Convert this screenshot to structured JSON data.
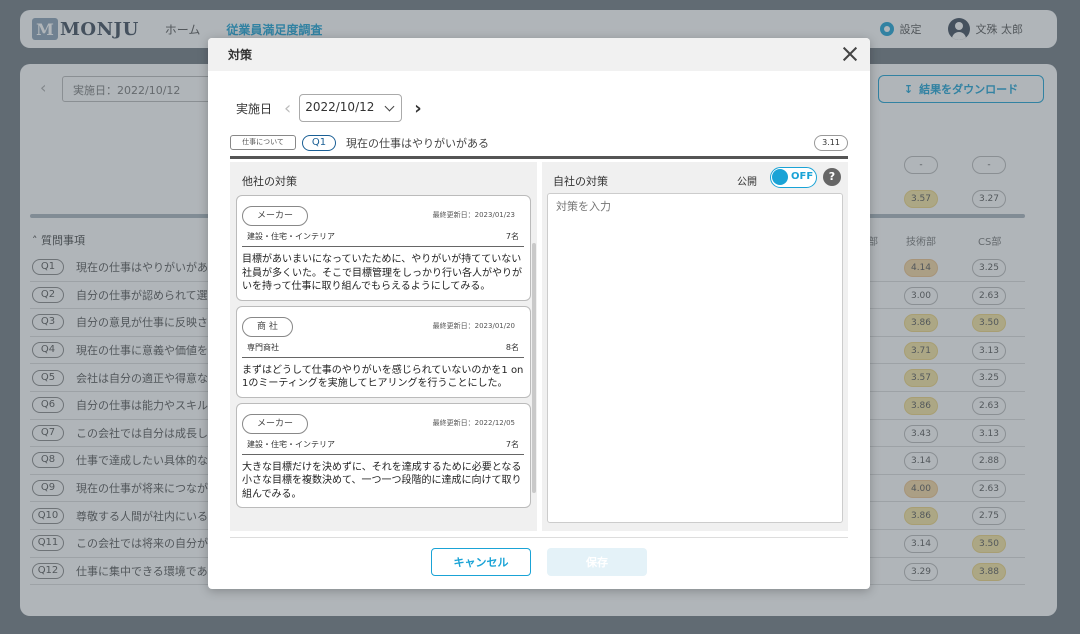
{
  "app": {
    "logo": "MONJU",
    "nav": [
      "ホーム",
      "従業員満足度調査"
    ],
    "settings_label": "設定",
    "user_name": "文殊 太郎"
  },
  "background": {
    "date_field": "実施日：2022/10/12",
    "download_label": "結果をダウンロード",
    "section_title": "質問事項",
    "columns": [
      "部",
      "技術部",
      "CS部"
    ],
    "summary_scores": [
      "-",
      "-",
      "3.57",
      "3.27"
    ],
    "rows": [
      {
        "q": "Q1",
        "text": "現在の仕事はやりがいがあ",
        "s1": "4.14",
        "s2": "3.25"
      },
      {
        "q": "Q2",
        "text": "自分の仕事が認められて選",
        "s1": "3.00",
        "s2": "2.63"
      },
      {
        "q": "Q3",
        "text": "自分の意見が仕事に反映さ",
        "s1": "3.86",
        "s2": "3.50"
      },
      {
        "q": "Q4",
        "text": "現在の仕事に意義や価値を",
        "s1": "3.71",
        "s2": "3.13"
      },
      {
        "q": "Q5",
        "text": "会社は自分の適正や得意な",
        "s1": "3.57",
        "s2": "3.25"
      },
      {
        "q": "Q6",
        "text": "自分の仕事は能力やスキル",
        "s1": "3.86",
        "s2": "2.63"
      },
      {
        "q": "Q7",
        "text": "この会社では自分は成長し",
        "s1": "3.43",
        "s2": "3.13"
      },
      {
        "q": "Q8",
        "text": "仕事で達成したい具体的な",
        "s1": "3.14",
        "s2": "2.88"
      },
      {
        "q": "Q9",
        "text": "現在の仕事が将来につなが",
        "s1": "4.00",
        "s2": "2.63"
      },
      {
        "q": "Q10",
        "text": "尊敬する人間が社内にいる",
        "s1": "3.86",
        "s2": "2.75"
      },
      {
        "q": "Q11",
        "text": "この会社では将来の自分が",
        "s1": "3.14",
        "s2": "3.50"
      },
      {
        "q": "Q12",
        "text": "仕事に集中できる環境であ",
        "s1": "3.29",
        "s2": "3.88"
      }
    ]
  },
  "modal": {
    "title": "対策",
    "date_label": "実施日",
    "date_value": "2022/10/12",
    "category_tag": "仕事について",
    "question_id": "Q1",
    "question_text": "現在の仕事はやりがいがある",
    "question_score": "3.11",
    "other_title": "他社の対策",
    "own_title": "自社の対策",
    "public_label": "公開",
    "toggle_text": "OFF",
    "help": "?",
    "input_placeholder": "対策を入力",
    "cancel_label": "キャンセル",
    "save_label": "保存",
    "cards": [
      {
        "tag": "メーカー",
        "updated": "最終更新日：2023/01/23",
        "industry": "建設・住宅・インテリア",
        "count": "7名",
        "body": "目標があいまいになっていたために、やりがいが持てていない社員が多くいた。そこで目標管理をしっかり行い各人がやりがいを持って仕事に取り組んでもらえるようにしてみる。"
      },
      {
        "tag": "商 社",
        "updated": "最終更新日：2023/01/20",
        "industry": "専門商社",
        "count": "8名",
        "body": "まずはどうして仕事のやりがいを感じられていないのかを1 on 1のミーティングを実施してヒアリングを行うことにした。"
      },
      {
        "tag": "メーカー",
        "updated": "最終更新日：2022/12/05",
        "industry": "建設・住宅・インテリア",
        "count": "7名",
        "body": "大きな目標だけを決めずに、それを達成するために必要となる小さな目標を複数決めて、一つ一つ段階的に達成に向けて取り組んでみる。"
      }
    ]
  }
}
